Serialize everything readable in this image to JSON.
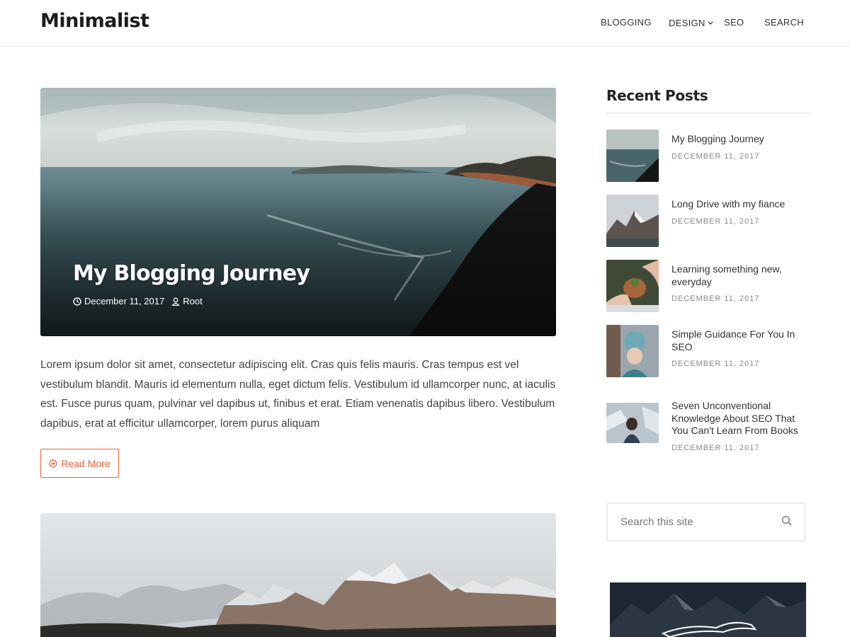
{
  "site": {
    "title": "Minimalist"
  },
  "nav": {
    "items": [
      {
        "label": "BLOGGING"
      },
      {
        "label": "DESIGN",
        "has_dropdown": true,
        "icon": "chevron-down-icon"
      },
      {
        "label": "SEO"
      },
      {
        "label": "SEARCH"
      }
    ]
  },
  "featured_post": {
    "title": "My Blogging Journey",
    "date": "December 11, 2017",
    "author": "Root",
    "date_icon": "clock-icon",
    "author_icon": "user-icon",
    "excerpt": "Lorem ipsum dolor sit amet, consectetur adipiscing elit. Cras quis felis mauris. Cras tempus est vel vestibulum blandit. Mauris id elementum nulla, eget dictum felis. Vestibulum id ullamcorper nunc, at iaculis est. Fusce purus quam, pulvinar vel dapibus ut, finibus et erat. Etiam venenatis dapibus libero. Vestibulum dapibus, erat at efficitur ullamcorper, lorem purus aliquam",
    "read_more_label": "Read More",
    "read_more_icon": "arrow-circle-icon"
  },
  "sidebar": {
    "recent_posts": {
      "title": "Recent Posts",
      "items": [
        {
          "title": "My Blogging Journey",
          "date": "DECEMBER 11, 2017"
        },
        {
          "title": "Long Drive with my fiance",
          "date": "DECEMBER 11, 2017"
        },
        {
          "title": "Learning something new, everyday",
          "date": "DECEMBER 11, 2017"
        },
        {
          "title": "Simple Guidance For You In SEO",
          "date": "DECEMBER 11, 2017"
        },
        {
          "title": "Seven Unconventional Knowledge About SEO That You Can't Learn From Books",
          "date": "DECEMBER 11, 2017"
        }
      ]
    },
    "search": {
      "placeholder": "Search this site",
      "icon": "search-icon"
    }
  },
  "colors": {
    "accent": "#e8643f",
    "text": "#444444",
    "heading": "#222222",
    "meta": "#888888"
  }
}
